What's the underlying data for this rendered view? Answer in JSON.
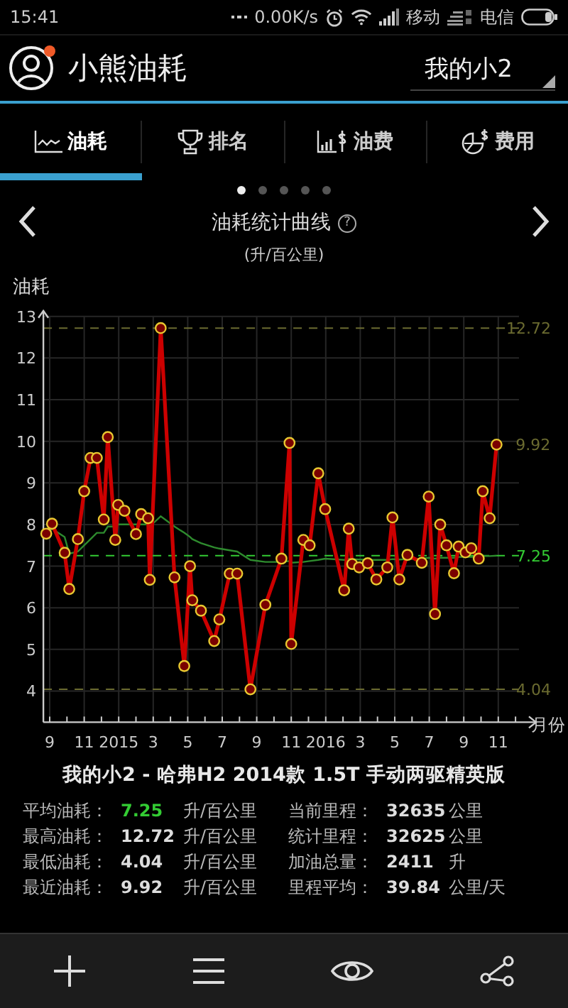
{
  "status_bar": {
    "time": "15:41",
    "net_speed": "0.00K/s",
    "carriers": [
      "移动",
      "电信"
    ]
  },
  "header": {
    "title": "小熊油耗",
    "has_notification": true,
    "vehicle_dropdown": "我的小2"
  },
  "tabs": [
    {
      "label": "油耗",
      "kind": "line-chart",
      "selected": true
    },
    {
      "label": "排名",
      "kind": "trophy",
      "selected": false
    },
    {
      "label": "油费",
      "kind": "bar-dollar",
      "selected": false
    },
    {
      "label": "费用",
      "kind": "pie-dollar",
      "selected": false
    }
  ],
  "pager": [
    {
      "selected": true
    },
    {
      "selected": false
    },
    {
      "selected": false
    },
    {
      "selected": false
    },
    {
      "selected": false
    }
  ],
  "chart_header": {
    "title": "油耗统计曲线",
    "help": "?",
    "unit": "(升/百公里)"
  },
  "chart": {
    "chart_data": {
      "type": "line",
      "ylabel": "油耗",
      "xlabel": "月份",
      "x": [
        "2014-08-25",
        "2014-09-05",
        "2014-09-27",
        "2014-10-05",
        "2014-10-20",
        "2014-11-01",
        "2014-11-12",
        "2014-11-23",
        "2014-12-05",
        "2014-12-12",
        "2014-12-25",
        "2014-12-30",
        "2015-01-11",
        "2015-02-01",
        "2015-02-10",
        "2015-02-22",
        "2015-02-25",
        "2015-03-14",
        "2015-04-08",
        "2015-04-25",
        "2015-05-05",
        "2015-05-09",
        "2015-05-24",
        "2015-06-17",
        "2015-06-26",
        "2015-07-14",
        "2015-07-27",
        "2015-08-20",
        "2015-09-16",
        "2015-10-14",
        "2015-10-28",
        "2015-10-31",
        "2015-11-22",
        "2015-12-03",
        "2015-12-18",
        "2015-12-30",
        "2016-02-03",
        "2016-02-11",
        "2016-02-17",
        "2016-02-29",
        "2016-03-14",
        "2016-03-29",
        "2016-04-18",
        "2016-04-27",
        "2016-05-09",
        "2016-05-23",
        "2016-06-18",
        "2016-06-30",
        "2016-07-11",
        "2016-07-20",
        "2016-07-31",
        "2016-08-14",
        "2016-08-22",
        "2016-09-04",
        "2016-09-14",
        "2016-09-27",
        "2016-10-04",
        "2016-10-16",
        "2016-10-28"
      ],
      "series": [
        {
          "color": "#cc0000",
          "marker": "circle",
          "values": [
            7.78,
            8.02,
            7.32,
            6.45,
            7.65,
            8.8,
            9.6,
            9.6,
            8.12,
            10.1,
            7.63,
            8.47,
            8.33,
            7.77,
            8.25,
            8.15,
            6.67,
            12.72,
            6.73,
            4.6,
            7.0,
            6.18,
            5.93,
            5.2,
            5.72,
            6.82,
            6.82,
            4.04,
            6.07,
            7.18,
            9.96,
            5.13,
            7.63,
            7.5,
            9.23,
            8.37,
            6.42,
            7.9,
            7.05,
            6.97,
            7.07,
            6.68,
            6.97,
            8.17,
            6.68,
            7.27,
            7.08,
            8.67,
            5.85,
            8.0,
            7.5,
            6.83,
            7.47,
            7.33,
            7.43,
            7.18,
            8.8,
            8.15,
            9.92
          ]
        },
        {
          "color": "#2e8b2e",
          "values": [
            7.78,
            7.9,
            7.7,
            7.3,
            7.35,
            7.5,
            7.65,
            7.8,
            7.8,
            7.95,
            7.95,
            8.0,
            8.0,
            8.0,
            8.0,
            8.0,
            7.95,
            8.2,
            7.95,
            7.8,
            7.7,
            7.65,
            7.55,
            7.45,
            7.42,
            7.38,
            7.35,
            7.15,
            7.1,
            7.1,
            7.12,
            7.08,
            7.1,
            7.12,
            7.15,
            7.18,
            7.15,
            7.18,
            7.17,
            7.16,
            7.15,
            7.15,
            7.15,
            7.17,
            7.16,
            7.17,
            7.18,
            7.2,
            7.18,
            7.2,
            7.2,
            7.2,
            7.22,
            7.22,
            7.22,
            7.22,
            7.24,
            7.24,
            7.25
          ]
        }
      ],
      "ylim": [
        3.25,
        13.2
      ],
      "xlim": [
        "2014-08-20",
        "2016-12-07"
      ],
      "yticks": [
        4,
        5,
        6,
        7,
        8,
        9,
        10,
        11,
        12,
        13
      ],
      "xticks": [
        {
          "value": "2014-09-01",
          "label": "9"
        },
        {
          "value": "2014-11-01",
          "label": "11"
        },
        {
          "value": "2015-01-01",
          "label": "2015"
        },
        {
          "value": "2015-03-01",
          "label": "3"
        },
        {
          "value": "2015-05-01",
          "label": "5"
        },
        {
          "value": "2015-07-01",
          "label": "7"
        },
        {
          "value": "2015-09-01",
          "label": "9"
        },
        {
          "value": "2015-11-01",
          "label": "11"
        },
        {
          "value": "2016-01-01",
          "label": "2016"
        },
        {
          "value": "2016-03-01",
          "label": "3"
        },
        {
          "value": "2016-05-01",
          "label": "5"
        },
        {
          "value": "2016-07-01",
          "label": "7"
        },
        {
          "value": "2016-09-01",
          "label": "9"
        },
        {
          "value": "2016-11-01",
          "label": "11"
        }
      ],
      "grid": true,
      "ref_lines": [
        {
          "axis": "y",
          "value": 12.72,
          "label": "12.72",
          "color": "#6b6b30"
        },
        {
          "axis": "y",
          "value": 7.25,
          "label": "7.25",
          "color": "#33cc33"
        },
        {
          "axis": "y",
          "value": 4.04,
          "label": "4.04",
          "color": "#6b6b30"
        }
      ],
      "annotations": [
        {
          "text": "9.92",
          "x": "2016-10-28",
          "y": 9.92
        }
      ]
    }
  },
  "vehicle_title": "我的小2 - 哈弗H2 2014款 1.5T 手动两驱精英版",
  "stats": [
    {
      "label": "平均油耗：",
      "value": "7.25",
      "unit": "升/百公里",
      "highlight": true
    },
    {
      "label": "当前里程：",
      "value": "32635",
      "unit": "公里",
      "highlight": false
    },
    {
      "label": "最高油耗：",
      "value": "12.72",
      "unit": "升/百公里",
      "highlight": false
    },
    {
      "label": "统计里程：",
      "value": "32625",
      "unit": "公里",
      "highlight": false
    },
    {
      "label": "最低油耗：",
      "value": "4.04",
      "unit": "升/百公里",
      "highlight": false
    },
    {
      "label": "加油总量：",
      "value": "2411",
      "unit": "升",
      "highlight": false
    },
    {
      "label": "最近油耗：",
      "value": "9.92",
      "unit": "升/百公里",
      "highlight": false
    },
    {
      "label": "里程平均：",
      "value": "39.84",
      "unit": "公里/天",
      "highlight": false
    }
  ],
  "bottom_bar": [
    {
      "kind": "plus"
    },
    {
      "kind": "menu"
    },
    {
      "kind": "eye"
    },
    {
      "kind": "share"
    }
  ]
}
